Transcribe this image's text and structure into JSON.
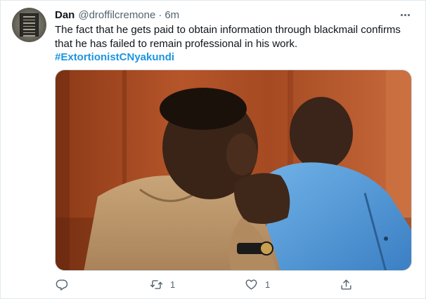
{
  "author": {
    "name": "Dan",
    "handle": "@droffilcremone",
    "separator": "·",
    "time": "6m"
  },
  "tweet": {
    "lines": [
      "The fact that he gets paid to obtain information through blackmail confirms",
      "that he has failed to remain professional in his work."
    ],
    "hashtag": "#ExtortionistCNyakundi"
  },
  "actions": {
    "reply_count": "",
    "retweet_count": "1",
    "like_count": "1",
    "share_count": ""
  },
  "icons": {
    "more": "more-horizontal-icon",
    "reply": "reply-icon",
    "retweet": "retweet-icon",
    "like": "heart-icon",
    "share": "share-icon"
  },
  "colors": {
    "hashtag": "#1b95e0",
    "secondary_text": "#536471",
    "primary_text": "#0f1419"
  }
}
